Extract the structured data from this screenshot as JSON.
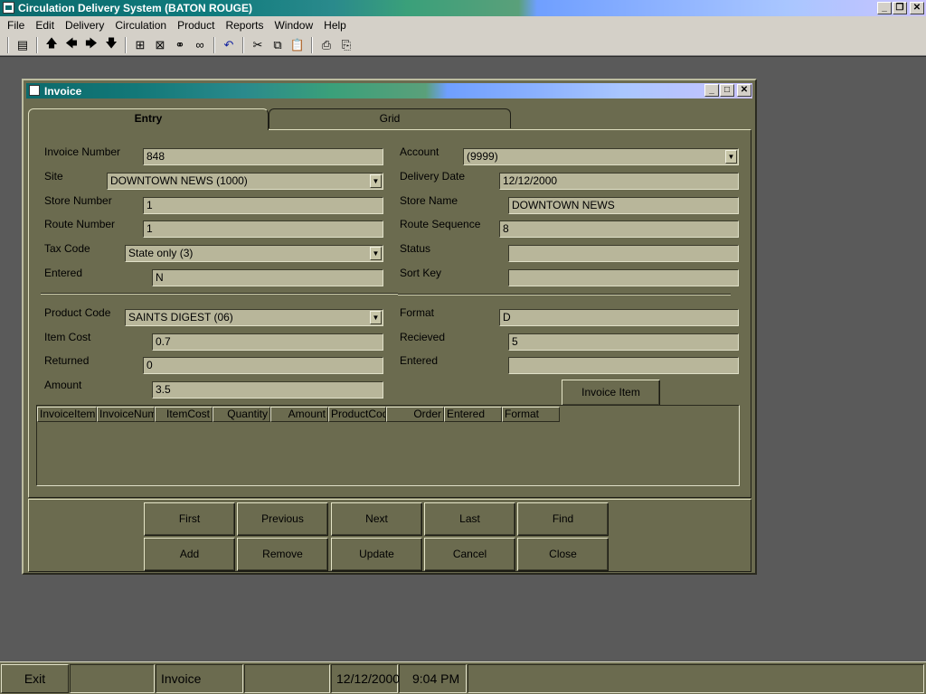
{
  "app": {
    "title": "Circulation Delivery System (BATON ROUGE)",
    "window_controls": {
      "minimize": "_",
      "restore": "❐",
      "close": "✕"
    }
  },
  "menu": [
    "File",
    "Edit",
    "Delivery",
    "Circulation",
    "Product",
    "Reports",
    "Window",
    "Help"
  ],
  "toolbar": {
    "icons": [
      "save-icon",
      "arrow-up-icon",
      "arrow-left-icon",
      "arrow-right-icon",
      "arrow-down-icon",
      "add-record-icon",
      "delete-record-icon",
      "find-icon",
      "binoculars-icon",
      "undo-icon",
      "cut-icon",
      "copy-icon",
      "paste-icon",
      "print-icon",
      "print-preview-icon"
    ]
  },
  "invoice": {
    "title": "Invoice",
    "window_controls": {
      "minimize": "_",
      "maximize": "□",
      "close": "✕"
    },
    "tabs": {
      "entry": "Entry",
      "grid": "Grid"
    },
    "labels": {
      "invoice_number": "Invoice Number",
      "site": "Site",
      "store_number": "Store Number",
      "route_number": "Route Number",
      "tax_code": "Tax Code",
      "entered": "Entered",
      "account": "Account",
      "delivery_date": "Delivery Date",
      "store_name": "Store Name",
      "route_sequence": "Route Sequence",
      "status": "Status",
      "sort_key": "Sort Key",
      "product_code": "Product Code",
      "item_cost": "Item Cost",
      "returned": "Returned",
      "amount": "Amount",
      "format": "Format",
      "recieved": "Recieved",
      "item_entered": "Entered"
    },
    "values": {
      "invoice_number": "848",
      "site": "DOWNTOWN NEWS (1000)",
      "store_number": "1",
      "route_number": "1",
      "tax_code": "State only (3)",
      "entered": "N",
      "account": "(9999)",
      "delivery_date": "12/12/2000",
      "store_name": "DOWNTOWN NEWS",
      "route_sequence": "8",
      "status": "",
      "sort_key": "",
      "product_code": "SAINTS DIGEST (06)",
      "item_cost": "0.7",
      "returned": "0",
      "amount": "3.5",
      "format": "D",
      "recieved": "5",
      "item_entered": ""
    },
    "invoice_item_button": "Invoice Item",
    "grid_columns": [
      "InvoiceItemID",
      "InvoiceNum",
      "ItemCost",
      "Quantity",
      "Amount",
      "ProductCode",
      "Order",
      "Entered",
      "Format"
    ],
    "nav_buttons": {
      "first": "First",
      "previous": "Previous",
      "next": "Next",
      "last": "Last",
      "find": "Find",
      "add": "Add",
      "remove": "Remove",
      "update": "Update",
      "cancel": "Cancel",
      "close": "Close"
    }
  },
  "statusbar": {
    "exit": "Exit",
    "panel_1": "",
    "active_window": "Invoice",
    "panel_3": "",
    "date": "12/12/2000",
    "time": "9:04 PM"
  },
  "colors": {
    "form_bg": "#6b6b4f",
    "field_bg": "#b8b69a",
    "desktop_bg": "#5a5a5a",
    "title_gradient_start": "#0c6a6c",
    "title_gradient_end": "#c9c2ff"
  }
}
